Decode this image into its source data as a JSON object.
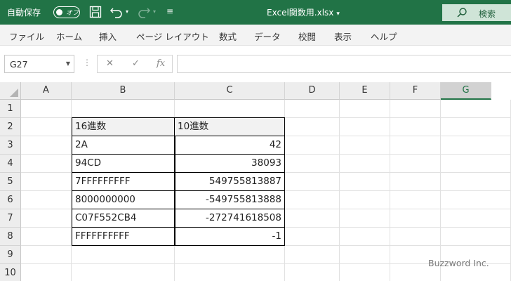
{
  "titlebar": {
    "autosave_label": "自動保存",
    "autosave_state": "オフ",
    "filename": "Excel関数用.xlsx",
    "filename_caret": "▾",
    "search_label": "検索",
    "accent": "#217346"
  },
  "ribbon": {
    "tabs": [
      "ファイル",
      "ホーム",
      "挿入",
      "ページ レイアウト",
      "数式",
      "データ",
      "校閲",
      "表示",
      "ヘルプ"
    ]
  },
  "formula_bar": {
    "name_box": "G27",
    "cancel": "✕",
    "enter": "✓",
    "fx": "fx",
    "formula": ""
  },
  "grid": {
    "columns": [
      "A",
      "B",
      "C",
      "D",
      "E",
      "F",
      "G"
    ],
    "selected_column": "G",
    "rows": [
      "1",
      "2",
      "3",
      "4",
      "5",
      "6",
      "7",
      "8",
      "9",
      "10"
    ],
    "table": {
      "headers": [
        "16進数",
        "10進数"
      ],
      "rows": [
        [
          "2A",
          "42"
        ],
        [
          "94CD",
          "38093"
        ],
        [
          "7FFFFFFFFF",
          "549755813887"
        ],
        [
          "8000000000",
          "-549755813888"
        ],
        [
          "C07F552CB4",
          "-272741618508"
        ],
        [
          "FFFFFFFFFF",
          "-1"
        ]
      ]
    }
  },
  "watermark": "Buzzword Inc."
}
